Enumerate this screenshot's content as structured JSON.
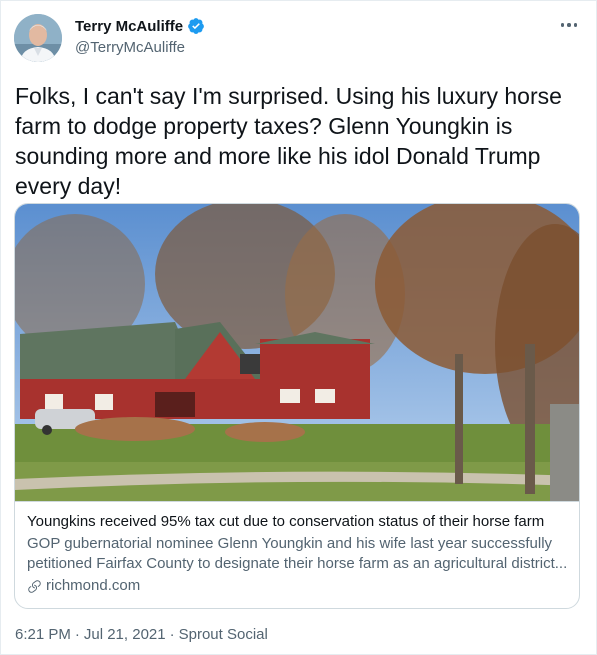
{
  "author": {
    "name": "Terry McAuliffe",
    "handle": "@TerryMcAuliffe",
    "verified": true,
    "verified_color": "#1d9bf0"
  },
  "tweet": {
    "text": "Folks, I can't say I'm surprised. Using his luxury horse farm to dodge property taxes? Glenn Youngkin is sounding more and more like his idol Donald Trump every day!"
  },
  "card": {
    "title": "Youngkins received 95% tax cut due to conservation status of their horse farm",
    "description": "GOP gubernatorial nominee Glenn Youngkin and his wife last year successfully petitioned Fairfax County to designate their horse farm as an agricultural district...",
    "domain": "richmond.com",
    "link_icon": "link-icon"
  },
  "meta": {
    "time": "6:21 PM",
    "separator1": "·",
    "date": "Jul 21, 2021",
    "separator2": "·",
    "source": "Sprout Social"
  }
}
